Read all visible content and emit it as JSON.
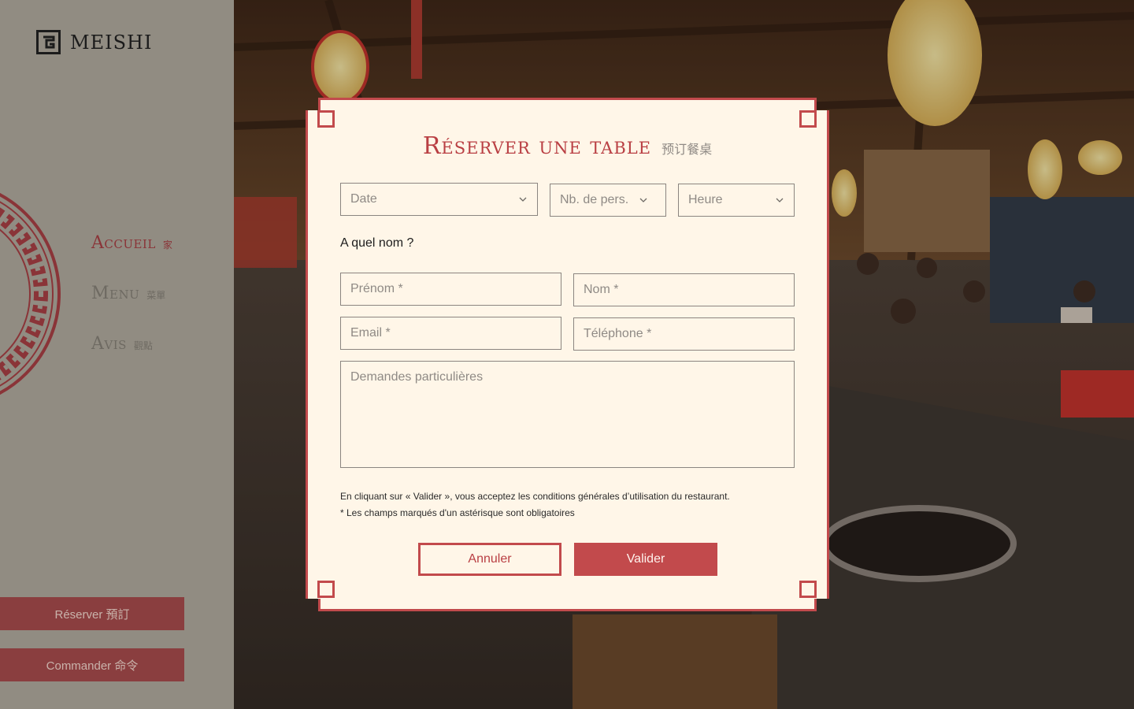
{
  "brand": {
    "name": "MEISHI",
    "icon": "meishi-logo-icon"
  },
  "nav": {
    "items": [
      {
        "label": "Accueil",
        "cn": "家",
        "active": true
      },
      {
        "label": "Menu",
        "cn": "菜單",
        "active": false
      },
      {
        "label": "Avis",
        "cn": "觀點",
        "active": false
      }
    ]
  },
  "sidebar_buttons": {
    "reserve": "Réserver 預訂",
    "order": "Commander 命令"
  },
  "modal": {
    "title": "Réserver une table",
    "title_cn": "预订餐桌",
    "date_placeholder": "Date",
    "guests_placeholder": "Nb. de pers.",
    "time_placeholder": "Heure",
    "name_question": "A quel nom ?",
    "firstname_placeholder": "Prénom *",
    "lastname_placeholder": "Nom *",
    "email_placeholder": "Email *",
    "phone_placeholder": "Téléphone *",
    "requests_placeholder": "Demandes particulières",
    "legal_terms": "En cliquant sur « Valider », vous acceptez les conditions générales d’utilisation du restaurant.",
    "legal_required": "* Les champs marqués d'un astérisque sont obligatoires",
    "cancel_label": "Annuler",
    "submit_label": "Valider"
  },
  "colors": {
    "accent": "#c24a4c",
    "modal_bg": "#fff6e8",
    "sidebar_bg": "#918c82",
    "sidebar_button": "#8a3e3f"
  }
}
